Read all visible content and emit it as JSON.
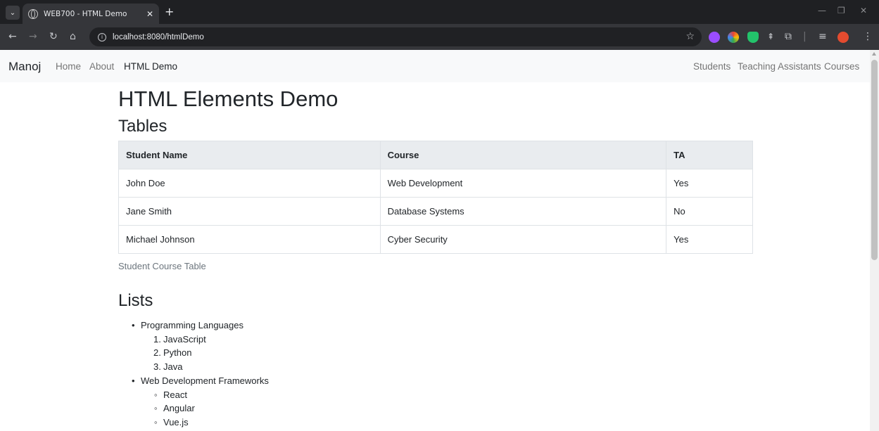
{
  "browser": {
    "tab_title": "WEB700 - HTML Demo",
    "url": "localhost:8080/htmlDemo"
  },
  "navbar": {
    "brand": "Manoj",
    "left_links": [
      "Home",
      "About",
      "HTML Demo"
    ],
    "active_link": "HTML Demo",
    "right_links": [
      "Students",
      "Teaching Assistants",
      "Courses"
    ]
  },
  "main": {
    "title": "HTML Elements Demo",
    "tables_heading": "Tables",
    "table": {
      "headers": [
        "Student Name",
        "Course",
        "TA"
      ],
      "rows": [
        [
          "John Doe",
          "Web Development",
          "Yes"
        ],
        [
          "Jane Smith",
          "Database Systems",
          "No"
        ],
        [
          "Michael Johnson",
          "Cyber Security",
          "Yes"
        ]
      ],
      "caption": "Student Course Table"
    },
    "lists_heading": "Lists",
    "lists": {
      "group1": {
        "label": "Programming Languages",
        "items": [
          "JavaScript",
          "Python",
          "Java"
        ]
      },
      "group2": {
        "label": "Web Development Frameworks",
        "items": [
          "React",
          "Angular",
          "Vue.js"
        ]
      }
    }
  },
  "colors": {
    "navbar_bg": "#f8f9fa",
    "table_header_bg": "#e9ecef",
    "text": "#212529",
    "muted": "#6c757d"
  }
}
